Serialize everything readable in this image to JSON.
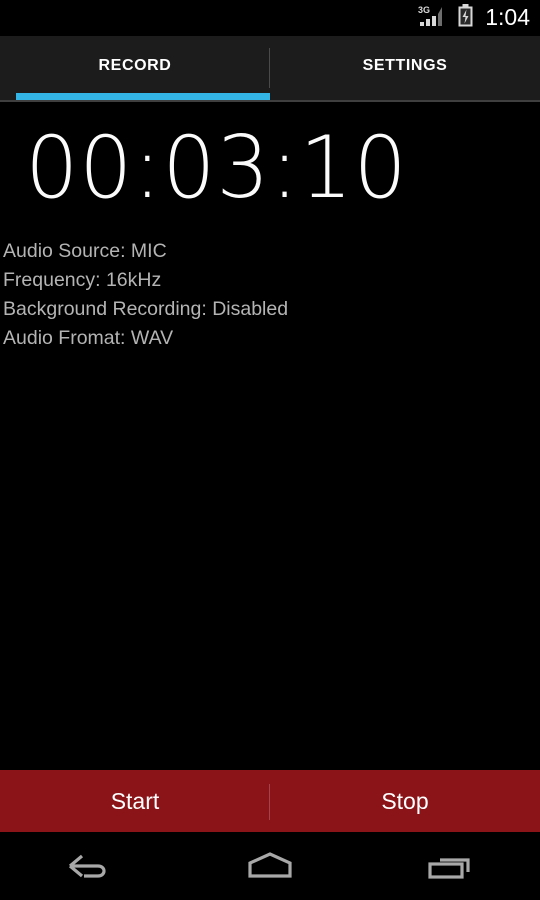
{
  "status_bar": {
    "network_label": "3G",
    "signal_icon": "signal-bars-icon",
    "signal_bars_filled": 3,
    "signal_bars_total": 4,
    "battery_icon": "battery-charging-icon",
    "time": "1:04"
  },
  "tabs": {
    "items": [
      {
        "label": "RECORD",
        "selected": true
      },
      {
        "label": "SETTINGS",
        "selected": false
      }
    ],
    "indicator_color": "#33b5e5"
  },
  "record": {
    "timer": "00:03:10",
    "info": [
      "Audio Source: MIC",
      "Frequency: 16kHz",
      "Background Recording: Disabled",
      "Audio Fromat: WAV"
    ]
  },
  "actions": {
    "bar_color": "#8a1418",
    "start_label": "Start",
    "stop_label": "Stop"
  },
  "nav_bar": {
    "back_icon": "back-arrow-icon",
    "home_icon": "home-icon",
    "recents_icon": "recents-icon"
  }
}
